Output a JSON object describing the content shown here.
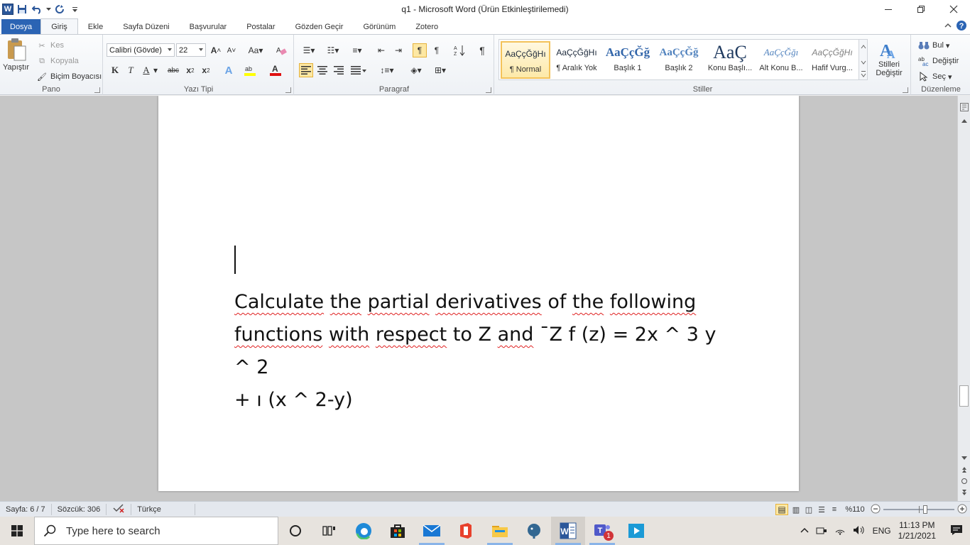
{
  "window": {
    "title": "q1  -  Microsoft Word (Ürün Etkinleştirilemedi)",
    "logo_letter": "W"
  },
  "tabs": [
    {
      "label": "Dosya"
    },
    {
      "label": "Giriş"
    },
    {
      "label": "Ekle"
    },
    {
      "label": "Sayfa Düzeni"
    },
    {
      "label": "Başvurular"
    },
    {
      "label": "Postalar"
    },
    {
      "label": "Gözden Geçir"
    },
    {
      "label": "Görünüm"
    },
    {
      "label": "Zotero"
    }
  ],
  "ribbon": {
    "pano": {
      "label": "Pano",
      "paste": "Yapıştır",
      "cut": "Kes",
      "copy": "Kopyala",
      "format_painter": "Biçim Boyacısı"
    },
    "font": {
      "label": "Yazı Tipi",
      "family": "Calibri (Gövde)",
      "size": "22"
    },
    "paragraph": {
      "label": "Paragraf",
      "pilcrow": "¶"
    },
    "styles": {
      "label": "Stiller",
      "items": [
        {
          "preview": "AaÇçĞğHı",
          "name": "¶ Normal"
        },
        {
          "preview": "AaÇçĞğHı",
          "name": "¶ Aralık Yok"
        },
        {
          "preview": "AaÇçĞğ",
          "name": "Başlık 1"
        },
        {
          "preview": "AaÇçĞğ",
          "name": "Başlık 2"
        },
        {
          "preview": "AaÇ",
          "name": "Konu Başlı..."
        },
        {
          "preview": "AaÇçĞğı",
          "name": "Alt Konu B..."
        },
        {
          "preview": "AaÇçĞğHı",
          "name": "Hafif Vurg..."
        }
      ],
      "change_styles_line1": "Stilleri",
      "change_styles_line2": "Değiştir"
    },
    "editing": {
      "label": "Düzenleme",
      "find": "Bul",
      "replace": "Değiştir",
      "select": "Seç"
    }
  },
  "document": {
    "line1_words": [
      "Calculate",
      "the",
      "partial",
      "derivatives",
      "of",
      "the",
      "following"
    ],
    "line2_words": [
      "functions",
      "with",
      "respect",
      "to",
      "Z",
      "and",
      "¯Z",
      "f",
      "(z)",
      "=",
      "2x",
      "^",
      "3",
      "y",
      "^",
      "2"
    ],
    "line3_words": [
      "+",
      "ı",
      "(x",
      "^",
      "2-y)"
    ]
  },
  "statusbar": {
    "page": "Sayfa: 6 / 7",
    "words": "Sözcük: 306",
    "language": "Türkçe",
    "zoom": "%110"
  },
  "taskbar": {
    "search_placeholder": "Type here to search",
    "language": "ENG",
    "time": "11:13 PM",
    "date": "1/21/2021",
    "teams_badge": "1"
  },
  "colors": {
    "accent": "#2b579a",
    "file_tab": "#2b64b4",
    "spellcheck": "#e02020",
    "doc_bg": "#c6c6c6"
  }
}
